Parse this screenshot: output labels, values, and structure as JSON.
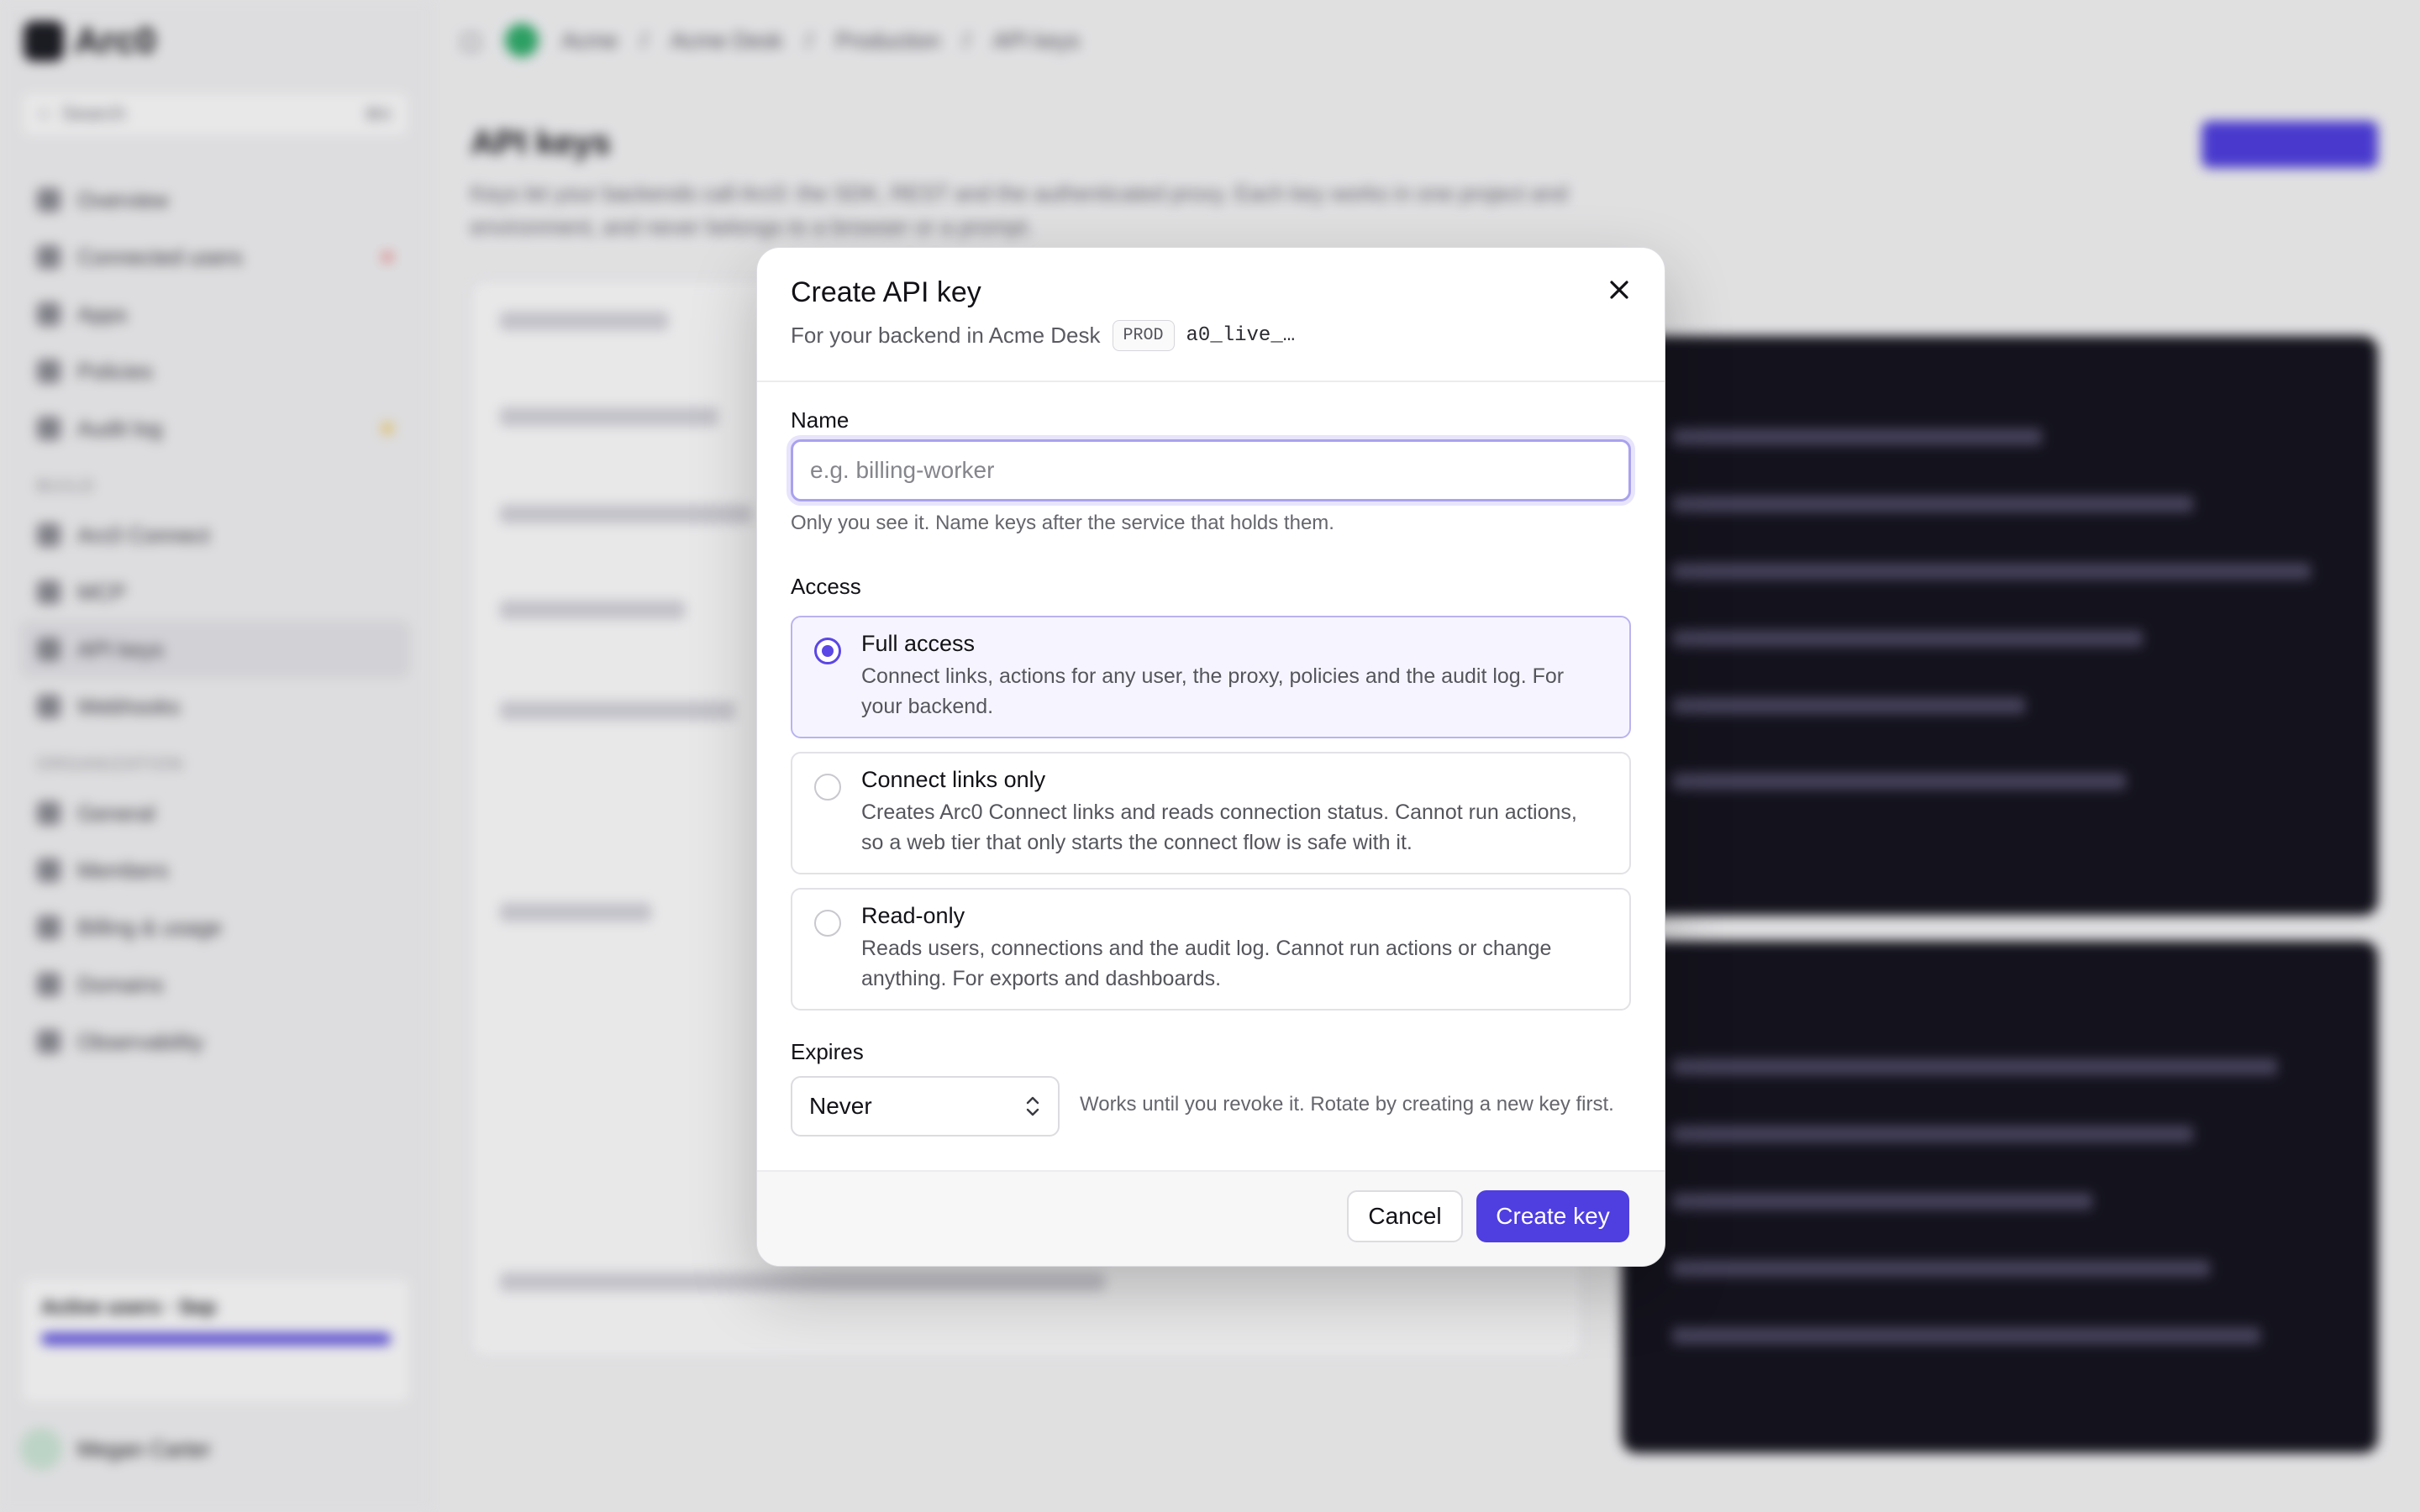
{
  "background": {
    "brand": "Arc0",
    "search_placeholder": "Search",
    "search_shortcut": "⌘K",
    "nav_primary": [
      {
        "label": "Overview",
        "icon": "grid-icon"
      },
      {
        "label": "Connected users",
        "icon": "users-icon"
      },
      {
        "label": "Apps",
        "icon": "apps-icon"
      },
      {
        "label": "Policies",
        "icon": "shield-icon"
      },
      {
        "label": "Audit log",
        "icon": "log-icon"
      }
    ],
    "section_build": "BUILD",
    "nav_build": [
      {
        "label": "Arc0 Connect",
        "icon": "link-icon"
      },
      {
        "label": "MCP",
        "icon": "plug-icon"
      },
      {
        "label": "API keys",
        "icon": "key-icon"
      },
      {
        "label": "Webhooks",
        "icon": "webhook-icon"
      }
    ],
    "section_org": "ORGANIZATION",
    "nav_org": [
      {
        "label": "General",
        "icon": "gear-icon"
      },
      {
        "label": "Members",
        "icon": "members-icon"
      },
      {
        "label": "Billing & usage",
        "icon": "card-icon"
      },
      {
        "label": "Domains",
        "icon": "globe-icon"
      },
      {
        "label": "Observability",
        "icon": "eye-icon"
      }
    ],
    "usage_label": "Active users · Sep",
    "user_name": "Megan Carter",
    "breadcrumbs": [
      "Acme",
      "Acme Desk",
      "Production",
      "API keys"
    ],
    "page_title": "API keys",
    "page_description": "Keys let your backends call Arc0: the SDK, REST and the authenticated proxy. Each key works in one project and environment, and never belongs to a browser or a prompt."
  },
  "modal": {
    "title": "Create API key",
    "subtitle": "For your backend in Acme Desk",
    "env_badge": "PROD",
    "key_prefix": "a0_live_…",
    "name_label": "Name",
    "name_placeholder": "e.g. billing-worker",
    "name_value": "",
    "name_help": "Only you see it. Name keys after the service that holds them.",
    "access_label": "Access",
    "access_options": [
      {
        "title": "Full access",
        "description": "Connect links, actions for any user, the proxy, policies and the audit log. For your backend.",
        "selected": true
      },
      {
        "title": "Connect links only",
        "description": "Creates Arc0 Connect links and reads connection status. Cannot run actions, so a web tier that only starts the connect flow is safe with it.",
        "selected": false
      },
      {
        "title": "Read-only",
        "description": "Reads users, connections and the audit log. Cannot run actions or change anything. For exports and dashboards.",
        "selected": false
      }
    ],
    "expires_label": "Expires",
    "expires_value": "Never",
    "expires_help": "Works until you revoke it. Rotate by creating a new key first.",
    "cancel_label": "Cancel",
    "create_label": "Create key"
  },
  "colors": {
    "accent": "#4f3ee0",
    "focus_ring": "#a9a2ee",
    "selected_bg": "#f6f5ff"
  }
}
